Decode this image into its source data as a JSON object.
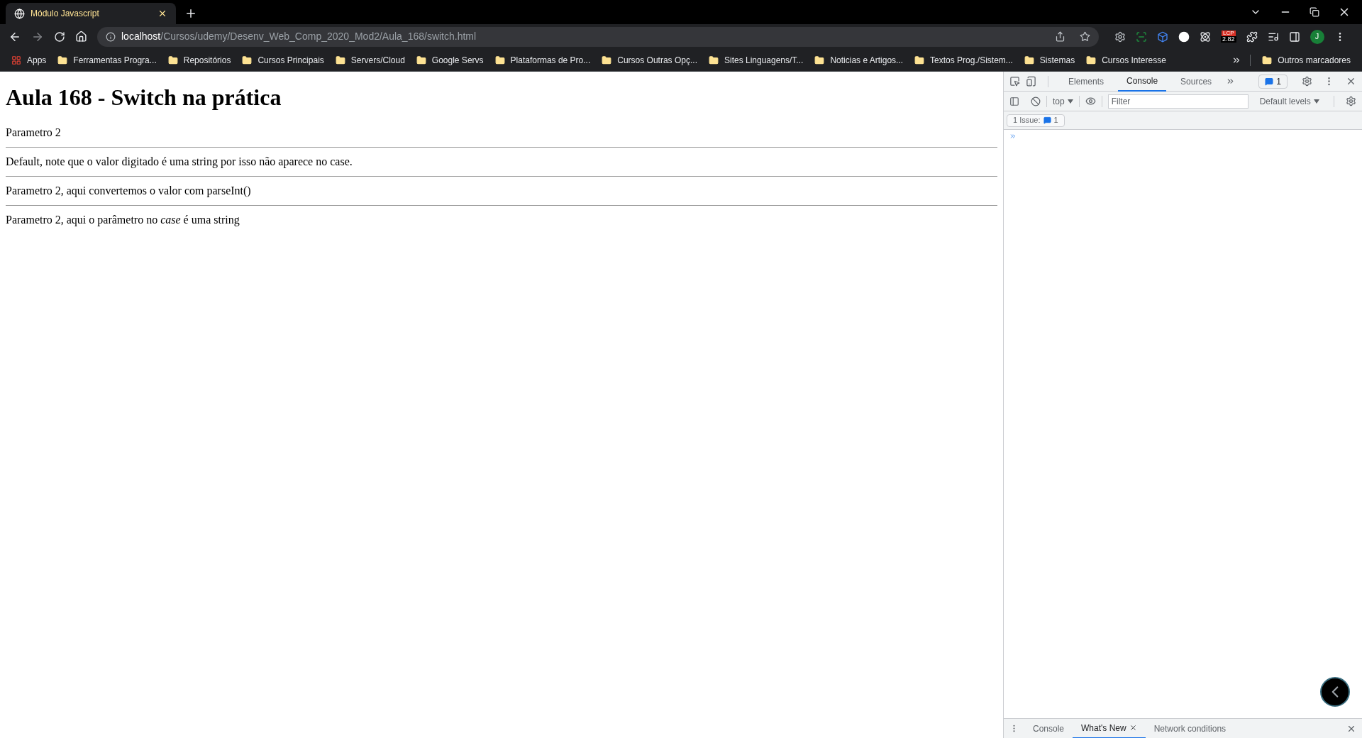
{
  "browser": {
    "tab": {
      "title": "Módulo Javascript",
      "selected": true
    },
    "address": {
      "host": "localhost",
      "path": "/Cursos/udemy/Desenv_Web_Comp_2020_Mod2/Aula_168/switch.html"
    },
    "lcp_badge": {
      "label": "LCP",
      "value": "2.82"
    },
    "avatar": "J",
    "bookmarks": [
      {
        "kind": "apps",
        "label": "Apps"
      },
      {
        "kind": "folder",
        "label": "Ferramentas Progra..."
      },
      {
        "kind": "folder",
        "label": "Repositórios"
      },
      {
        "kind": "folder",
        "label": "Cursos Principais"
      },
      {
        "kind": "folder",
        "label": "Servers/Cloud"
      },
      {
        "kind": "folder",
        "label": "Google Servs"
      },
      {
        "kind": "folder",
        "label": "Plataformas de Pro..."
      },
      {
        "kind": "folder",
        "label": "Cursos Outras Opç..."
      },
      {
        "kind": "folder",
        "label": "Sites Linguagens/T..."
      },
      {
        "kind": "folder",
        "label": "Noticias e Artigos..."
      },
      {
        "kind": "folder",
        "label": "Textos Prog./Sistem..."
      },
      {
        "kind": "folder",
        "label": "Sistemas"
      },
      {
        "kind": "folder",
        "label": "Cursos Interesse"
      }
    ],
    "other_bookmarks": "Outros marcadores"
  },
  "page": {
    "heading": "Aula 168 - Switch na prática",
    "paragraphs": [
      "Parametro 2",
      "Default, note que o valor digitado é uma string por isso não aparece no case.",
      "Parametro 2, aqui convertemos o valor com parseInt()",
      "Parametro 2, aqui o parâmetro no *case* é uma string"
    ]
  },
  "devtools": {
    "tabs": [
      {
        "label": "Elements",
        "selected": false
      },
      {
        "label": "Console",
        "selected": true
      },
      {
        "label": "Sources",
        "selected": false
      }
    ],
    "message_count": "1",
    "context": "top",
    "filter": {
      "placeholder": "Filter"
    },
    "levels": "Default levels",
    "issues": {
      "label": "1 Issue:",
      "count": "1"
    },
    "drawer_tabs": [
      {
        "label": "Console",
        "selected": false,
        "closable": false
      },
      {
        "label": "What's New",
        "selected": true,
        "closable": true
      },
      {
        "label": "Network conditions",
        "selected": false,
        "closable": false
      }
    ]
  }
}
